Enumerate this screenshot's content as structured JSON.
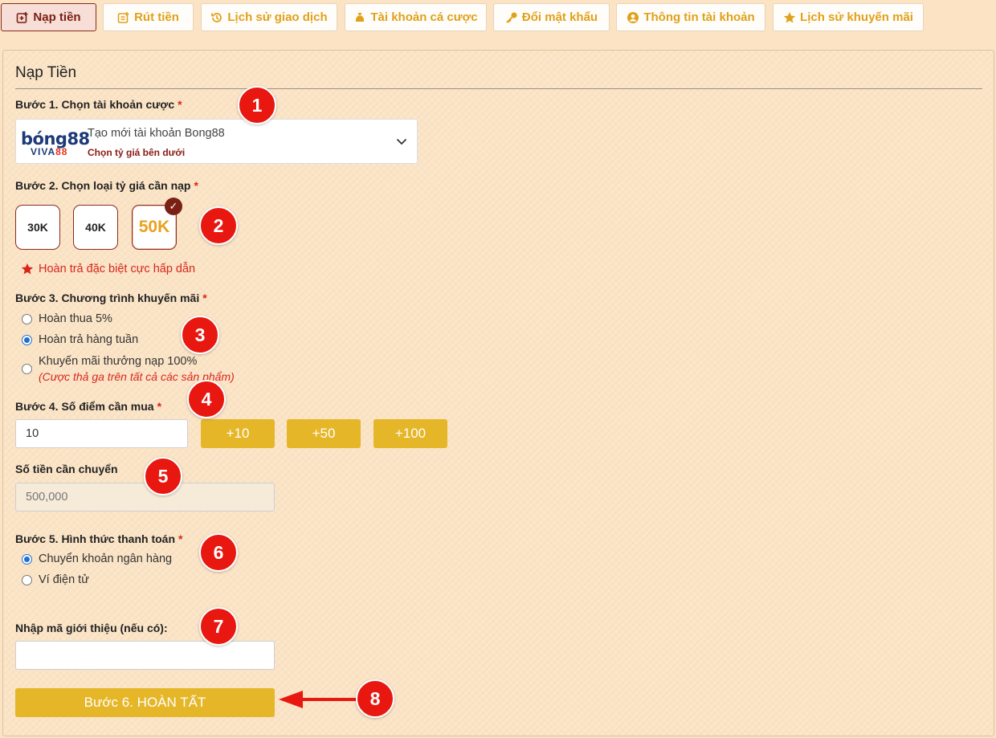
{
  "tabs": [
    {
      "label": "Nạp tiền",
      "icon": "deposit-icon"
    },
    {
      "label": "Rút tiền",
      "icon": "withdraw-icon"
    },
    {
      "label": "Lịch sử giao dịch",
      "icon": "history-icon"
    },
    {
      "label": "Tài khoản cá cược",
      "icon": "moneybag-icon"
    },
    {
      "label": "Đổi mật khẩu",
      "icon": "key-icon"
    },
    {
      "label": "Thông tin tài khoản",
      "icon": "user-circle-icon"
    },
    {
      "label": "Lịch sử khuyến mãi",
      "icon": "star-icon"
    }
  ],
  "form": {
    "title": "Nạp Tiền",
    "step1": {
      "label": "Bước 1. Chọn tài khoản cược",
      "required": "*",
      "logo_top": "bóng88",
      "logo_bottom_a": "VIVA",
      "logo_bottom_b": "88",
      "selected": "Tạo mới tài khoản Bong88",
      "sub": "Chọn tỷ giá bên dưới"
    },
    "step2": {
      "label": "Bước 2. Chọn loại tỷ giá cần nạp",
      "required": "*",
      "options": [
        "30K",
        "40K",
        "50K"
      ],
      "selected": "50K",
      "check": "✓",
      "note": "Hoàn trả đặc biệt cực hấp dẫn"
    },
    "step3": {
      "label": "Bước 3. Chương trình khuyến mãi",
      "required": "*",
      "options": [
        {
          "label": "Hoàn thua 5%",
          "checked": false
        },
        {
          "label": "Hoàn trả hàng tuần",
          "checked": true
        },
        {
          "label": "Khuyến mãi thưởng nạp 100%",
          "checked": false,
          "note": "(Cược thả ga trên tất cả các sản phẩm)"
        }
      ]
    },
    "step4": {
      "label": "Bước 4. Số điểm cần mua",
      "required": "*",
      "value": "10",
      "buttons": [
        "+10",
        "+50",
        "+100"
      ]
    },
    "amount": {
      "label": "Số tiền cần chuyển",
      "value": "500,000"
    },
    "step5": {
      "label": "Bước 5. Hình thức thanh toán",
      "required": "*",
      "options": [
        {
          "label": "Chuyển khoản ngân hàng",
          "checked": true
        },
        {
          "label": "Ví điện tử",
          "checked": false
        }
      ]
    },
    "referral": {
      "label": "Nhập mã giới thiệu (nếu có):",
      "value": ""
    },
    "submit_label": "Bước 6. HOÀN TẤT"
  },
  "markers": [
    "1",
    "2",
    "3",
    "4",
    "5",
    "6",
    "7",
    "8"
  ],
  "colors": {
    "accent_gold": "#e6b629",
    "tab_text": "#e0a11b",
    "active_tab": "#7a1f16",
    "required": "#d9251c",
    "marker": "#e8170f",
    "background": "#fbe3c3"
  }
}
